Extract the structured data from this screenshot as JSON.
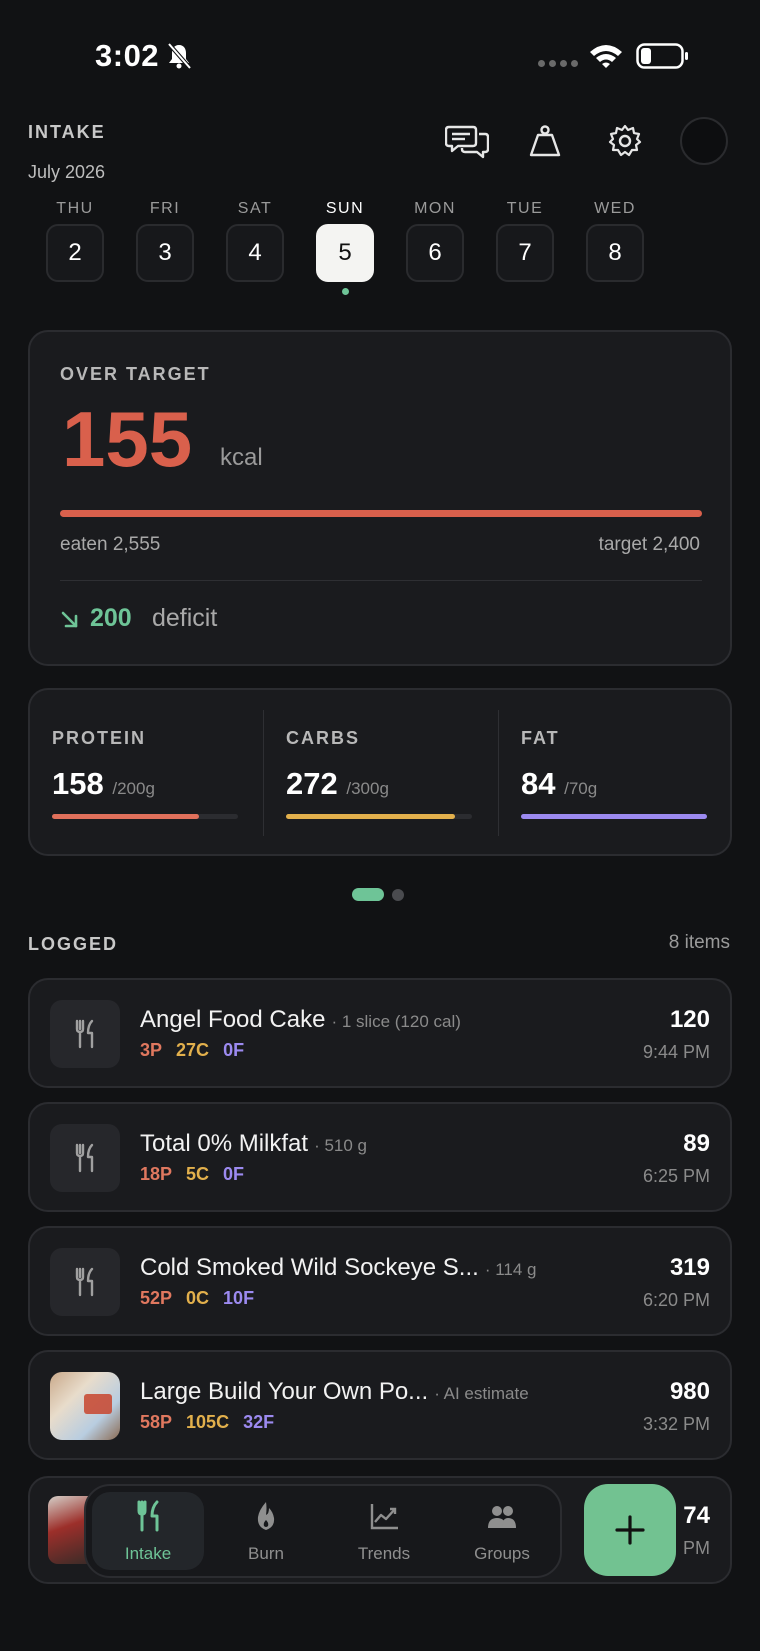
{
  "status": {
    "time": "3:02"
  },
  "header": {
    "title": "INTAKE",
    "month": "July 2026"
  },
  "week": [
    {
      "name": "THU",
      "num": "2"
    },
    {
      "name": "FRI",
      "num": "3"
    },
    {
      "name": "SAT",
      "num": "4"
    },
    {
      "name": "SUN",
      "num": "5",
      "active": true
    },
    {
      "name": "MON",
      "num": "6"
    },
    {
      "name": "TUE",
      "num": "7"
    },
    {
      "name": "WED",
      "num": "8"
    }
  ],
  "target_card": {
    "label": "OVER TARGET",
    "value": "155",
    "unit": "kcal",
    "eaten": "eaten 2,555",
    "target": "target 2,400",
    "deficit_value": "200",
    "deficit_label": "deficit"
  },
  "macros": [
    {
      "name": "PROTEIN",
      "value": "158",
      "goal": "/200g",
      "progress": 0.79,
      "color": "#e0705b"
    },
    {
      "name": "CARBS",
      "value": "272",
      "goal": "/300g",
      "progress": 0.91,
      "color": "#e2b04c"
    },
    {
      "name": "FAT",
      "value": "84",
      "goal": "/70g",
      "progress": 1.0,
      "color": "#9c8af0"
    }
  ],
  "logged": {
    "title": "LOGGED",
    "count": "8 items",
    "entries": [
      {
        "name": "Angel Food Cake",
        "meta": "· 1 slice (120 cal)",
        "p": "3P",
        "c": "27C",
        "f": "0F",
        "cal": "120",
        "time": "9:44 PM"
      },
      {
        "name": "Total 0% Milkfat",
        "meta": "· 510 g",
        "p": "18P",
        "c": "5C",
        "f": "0F",
        "cal": "89",
        "time": "6:25 PM"
      },
      {
        "name": "Cold Smoked Wild Sockeye S...",
        "meta": "· 114 g",
        "p": "52P",
        "c": "0C",
        "f": "10F",
        "cal": "319",
        "time": "6:20 PM"
      },
      {
        "name": "Large Build Your Own Po...",
        "meta": "· AI estimate",
        "p": "58P",
        "c": "105C",
        "f": "32F",
        "cal": "980",
        "time": "3:32 PM"
      }
    ],
    "partial": {
      "cal": "74",
      "time": "PM"
    }
  },
  "tabs": [
    {
      "label": "Intake",
      "icon": "fork-knife-icon",
      "active": true
    },
    {
      "label": "Burn",
      "icon": "flame-icon"
    },
    {
      "label": "Trends",
      "icon": "chart-icon"
    },
    {
      "label": "Groups",
      "icon": "people-icon"
    }
  ],
  "colors": {
    "accent": "#6ec497",
    "over": "#d9604c",
    "protein": "#e0785f",
    "carbs": "#e2b04c",
    "fat": "#9c8af0"
  }
}
